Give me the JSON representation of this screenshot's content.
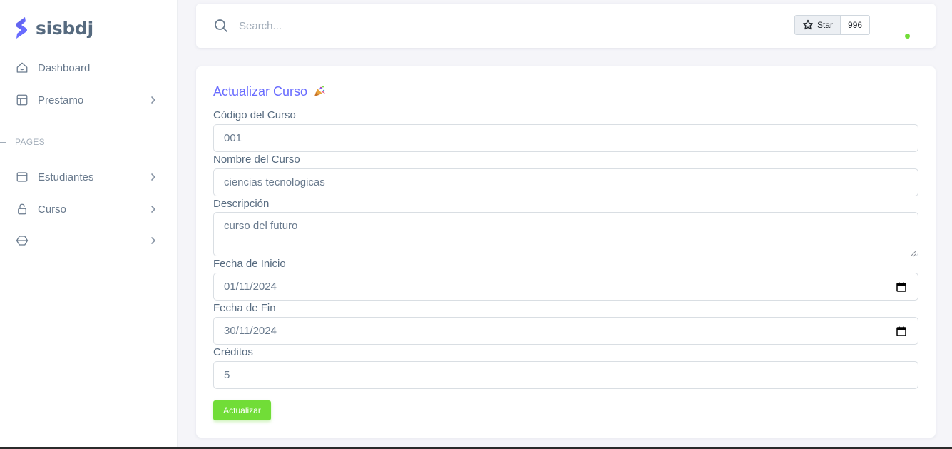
{
  "brand": {
    "name": "sisbdj",
    "logo_color": "#696cff"
  },
  "sidebar": {
    "items_top": [
      {
        "label": "Dashboard",
        "icon": "home-smile-icon",
        "has_children": false
      },
      {
        "label": "Prestamo",
        "icon": "layout-icon",
        "has_children": true
      }
    ],
    "section_header": "PAGES",
    "items_pages": [
      {
        "label": "Estudiantes",
        "icon": "window-icon",
        "has_children": true
      },
      {
        "label": "Curso",
        "icon": "lock-open-icon",
        "has_children": true
      },
      {
        "label": "",
        "icon": "cube-icon",
        "has_children": true
      }
    ]
  },
  "navbar": {
    "search_placeholder": "Search...",
    "github_star_label": "Star",
    "github_star_count": "996",
    "status": "online",
    "status_color": "#71dd37"
  },
  "form": {
    "title": "Actualizar Curso",
    "title_color": "#696cff",
    "fields": {
      "codigo": {
        "label": "Código del Curso",
        "value": "001"
      },
      "nombre": {
        "label": "Nombre del Curso",
        "value": "ciencias tecnologicas"
      },
      "descripcion": {
        "label": "Descripción",
        "value": "curso del futuro"
      },
      "fecha_inicio": {
        "label": "Fecha de Inicio",
        "value": "01/11/2024"
      },
      "fecha_fin": {
        "label": "Fecha de Fin",
        "value": "30/11/2024"
      },
      "creditos": {
        "label": "Créditos",
        "value": "5"
      }
    },
    "submit_label": "Actualizar",
    "submit_color": "#71dd37"
  }
}
